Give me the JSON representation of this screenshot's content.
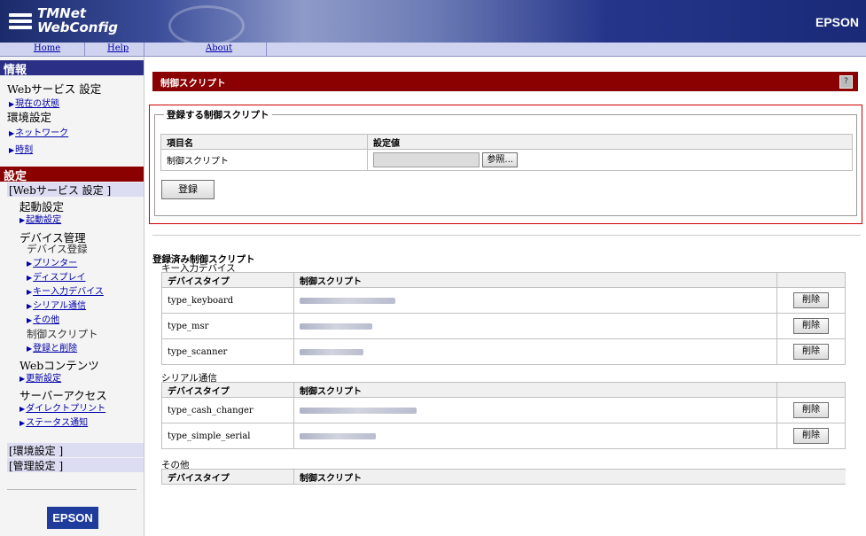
{
  "header": {
    "app_title_1": "TMNet",
    "app_title_2": "WebConfig",
    "brand": "EPSON"
  },
  "topnav": {
    "home": "Home",
    "help": "Help",
    "about": "About"
  },
  "sidebar": {
    "info_header": "情報",
    "web_service_settings": "Webサービス 設定",
    "current_status": "現在の状態",
    "env_settings": "環境設定",
    "network": "ネットワーク",
    "clock": "時刻",
    "settings_header": "設定",
    "web_service_band": "[Webサービス 設定 ]",
    "startup_settings": "起動設定",
    "startup_settings_link": "起動設定",
    "device_management": "デバイス管理",
    "device_registration": "デバイス登録",
    "printer": "プリンター",
    "display": "ディスプレイ",
    "key_input_device": "キー入力デバイス",
    "serial_comm": "シリアル通信",
    "other": "その他",
    "control_script": "制御スクリプト",
    "register_delete": "登録と削除",
    "web_contents": "Webコンテンツ",
    "update_settings": "更新設定",
    "server_access": "サーバーアクセス",
    "direct_print": "ダイレクトプリント",
    "status_notify": "ステータス通知",
    "env_settings_band": "[環境設定 ]",
    "admin_settings_band": "[管理設定 ]",
    "logo": "EPSON"
  },
  "main": {
    "title": "制御スクリプト",
    "help_icon": "?",
    "register_section": {
      "legend": "登録する制御スクリプト",
      "col_item": "項目名",
      "col_value": "設定値",
      "row_label": "制御スクリプト",
      "browse_button": "参照...",
      "register_button": "登録"
    },
    "registered": {
      "title": "登録済み制御スクリプト",
      "col_device_type": "デバイスタイプ",
      "col_script": "制御スクリプト",
      "delete_label": "削除",
      "groups": [
        {
          "name": "キー入力デバイス",
          "rows": [
            "type_keyboard",
            "type_msr",
            "type_scanner"
          ]
        },
        {
          "name": "シリアル通信",
          "rows": [
            "type_cash_changer",
            "type_simple_serial"
          ]
        },
        {
          "name": "その他",
          "rows": []
        }
      ]
    }
  }
}
